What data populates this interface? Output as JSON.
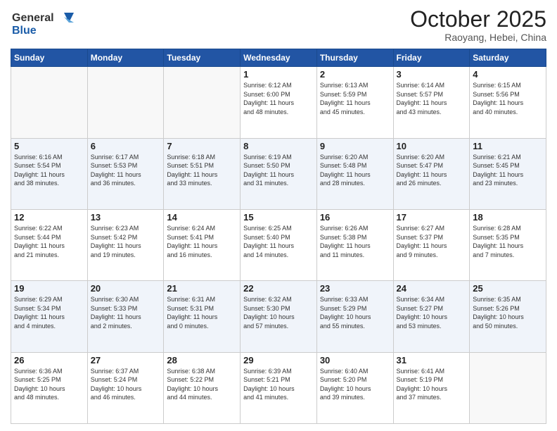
{
  "header": {
    "logo_line1": "General",
    "logo_line2": "Blue",
    "title": "October 2025",
    "subtitle": "Raoyang, Hebei, China"
  },
  "weekdays": [
    "Sunday",
    "Monday",
    "Tuesday",
    "Wednesday",
    "Thursday",
    "Friday",
    "Saturday"
  ],
  "weeks": [
    [
      {
        "day": "",
        "info": ""
      },
      {
        "day": "",
        "info": ""
      },
      {
        "day": "",
        "info": ""
      },
      {
        "day": "1",
        "info": "Sunrise: 6:12 AM\nSunset: 6:00 PM\nDaylight: 11 hours\nand 48 minutes."
      },
      {
        "day": "2",
        "info": "Sunrise: 6:13 AM\nSunset: 5:59 PM\nDaylight: 11 hours\nand 45 minutes."
      },
      {
        "day": "3",
        "info": "Sunrise: 6:14 AM\nSunset: 5:57 PM\nDaylight: 11 hours\nand 43 minutes."
      },
      {
        "day": "4",
        "info": "Sunrise: 6:15 AM\nSunset: 5:56 PM\nDaylight: 11 hours\nand 40 minutes."
      }
    ],
    [
      {
        "day": "5",
        "info": "Sunrise: 6:16 AM\nSunset: 5:54 PM\nDaylight: 11 hours\nand 38 minutes."
      },
      {
        "day": "6",
        "info": "Sunrise: 6:17 AM\nSunset: 5:53 PM\nDaylight: 11 hours\nand 36 minutes."
      },
      {
        "day": "7",
        "info": "Sunrise: 6:18 AM\nSunset: 5:51 PM\nDaylight: 11 hours\nand 33 minutes."
      },
      {
        "day": "8",
        "info": "Sunrise: 6:19 AM\nSunset: 5:50 PM\nDaylight: 11 hours\nand 31 minutes."
      },
      {
        "day": "9",
        "info": "Sunrise: 6:20 AM\nSunset: 5:48 PM\nDaylight: 11 hours\nand 28 minutes."
      },
      {
        "day": "10",
        "info": "Sunrise: 6:20 AM\nSunset: 5:47 PM\nDaylight: 11 hours\nand 26 minutes."
      },
      {
        "day": "11",
        "info": "Sunrise: 6:21 AM\nSunset: 5:45 PM\nDaylight: 11 hours\nand 23 minutes."
      }
    ],
    [
      {
        "day": "12",
        "info": "Sunrise: 6:22 AM\nSunset: 5:44 PM\nDaylight: 11 hours\nand 21 minutes."
      },
      {
        "day": "13",
        "info": "Sunrise: 6:23 AM\nSunset: 5:42 PM\nDaylight: 11 hours\nand 19 minutes."
      },
      {
        "day": "14",
        "info": "Sunrise: 6:24 AM\nSunset: 5:41 PM\nDaylight: 11 hours\nand 16 minutes."
      },
      {
        "day": "15",
        "info": "Sunrise: 6:25 AM\nSunset: 5:40 PM\nDaylight: 11 hours\nand 14 minutes."
      },
      {
        "day": "16",
        "info": "Sunrise: 6:26 AM\nSunset: 5:38 PM\nDaylight: 11 hours\nand 11 minutes."
      },
      {
        "day": "17",
        "info": "Sunrise: 6:27 AM\nSunset: 5:37 PM\nDaylight: 11 hours\nand 9 minutes."
      },
      {
        "day": "18",
        "info": "Sunrise: 6:28 AM\nSunset: 5:35 PM\nDaylight: 11 hours\nand 7 minutes."
      }
    ],
    [
      {
        "day": "19",
        "info": "Sunrise: 6:29 AM\nSunset: 5:34 PM\nDaylight: 11 hours\nand 4 minutes."
      },
      {
        "day": "20",
        "info": "Sunrise: 6:30 AM\nSunset: 5:33 PM\nDaylight: 11 hours\nand 2 minutes."
      },
      {
        "day": "21",
        "info": "Sunrise: 6:31 AM\nSunset: 5:31 PM\nDaylight: 11 hours\nand 0 minutes."
      },
      {
        "day": "22",
        "info": "Sunrise: 6:32 AM\nSunset: 5:30 PM\nDaylight: 10 hours\nand 57 minutes."
      },
      {
        "day": "23",
        "info": "Sunrise: 6:33 AM\nSunset: 5:29 PM\nDaylight: 10 hours\nand 55 minutes."
      },
      {
        "day": "24",
        "info": "Sunrise: 6:34 AM\nSunset: 5:27 PM\nDaylight: 10 hours\nand 53 minutes."
      },
      {
        "day": "25",
        "info": "Sunrise: 6:35 AM\nSunset: 5:26 PM\nDaylight: 10 hours\nand 50 minutes."
      }
    ],
    [
      {
        "day": "26",
        "info": "Sunrise: 6:36 AM\nSunset: 5:25 PM\nDaylight: 10 hours\nand 48 minutes."
      },
      {
        "day": "27",
        "info": "Sunrise: 6:37 AM\nSunset: 5:24 PM\nDaylight: 10 hours\nand 46 minutes."
      },
      {
        "day": "28",
        "info": "Sunrise: 6:38 AM\nSunset: 5:22 PM\nDaylight: 10 hours\nand 44 minutes."
      },
      {
        "day": "29",
        "info": "Sunrise: 6:39 AM\nSunset: 5:21 PM\nDaylight: 10 hours\nand 41 minutes."
      },
      {
        "day": "30",
        "info": "Sunrise: 6:40 AM\nSunset: 5:20 PM\nDaylight: 10 hours\nand 39 minutes."
      },
      {
        "day": "31",
        "info": "Sunrise: 6:41 AM\nSunset: 5:19 PM\nDaylight: 10 hours\nand 37 minutes."
      },
      {
        "day": "",
        "info": ""
      }
    ]
  ]
}
